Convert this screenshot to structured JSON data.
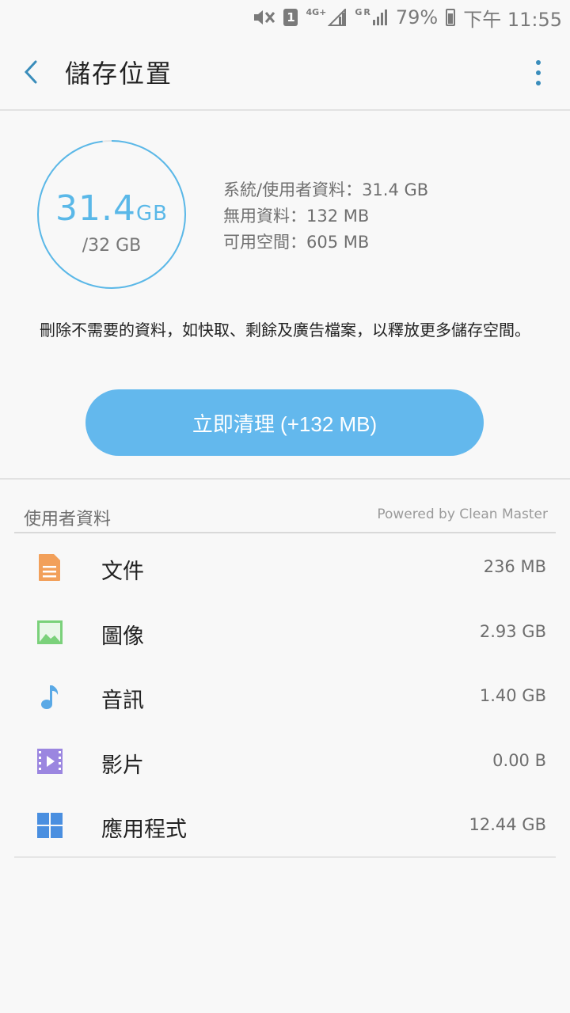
{
  "status_bar": {
    "sim": "1",
    "net1": "4G+",
    "net2": "G",
    "net2_extra": "R",
    "battery": "79%",
    "time": "下午 11:55"
  },
  "app_bar": {
    "title": "儲存位置",
    "back_icon": "chevron-left-icon",
    "more_icon": "more-vert-icon"
  },
  "summary": {
    "used_value": "31.4",
    "used_unit": "GB",
    "total": "/32 GB",
    "used_fraction": 0.98,
    "stats": [
      "系統/使用者資料：31.4 GB",
      "無用資料：132 MB",
      "可用空間：605 MB"
    ]
  },
  "description": "刪除不需要的資料，如快取、剩餘及廣告檔案，以釋放更多儲存空間。",
  "clean_button": "立即清理 (+132 MB)",
  "section": {
    "title": "使用者資料",
    "powered_by": "Powered by Clean Master"
  },
  "items": [
    {
      "label": "文件",
      "size": "236 MB",
      "icon": "document-icon",
      "color": "#f2a05a"
    },
    {
      "label": "圖像",
      "size": "2.93 GB",
      "icon": "image-icon",
      "color": "#7bd17b"
    },
    {
      "label": "音訊",
      "size": "1.40 GB",
      "icon": "music-note-icon",
      "color": "#5aa9e6"
    },
    {
      "label": "影片",
      "size": "0.00 B",
      "icon": "video-icon",
      "color": "#9b86e0"
    },
    {
      "label": "應用程式",
      "size": "12.44 GB",
      "icon": "apps-grid-icon",
      "color": "#4a8fe0"
    }
  ],
  "colors": {
    "accent": "#5ab8e8",
    "button": "#63b8ed"
  }
}
